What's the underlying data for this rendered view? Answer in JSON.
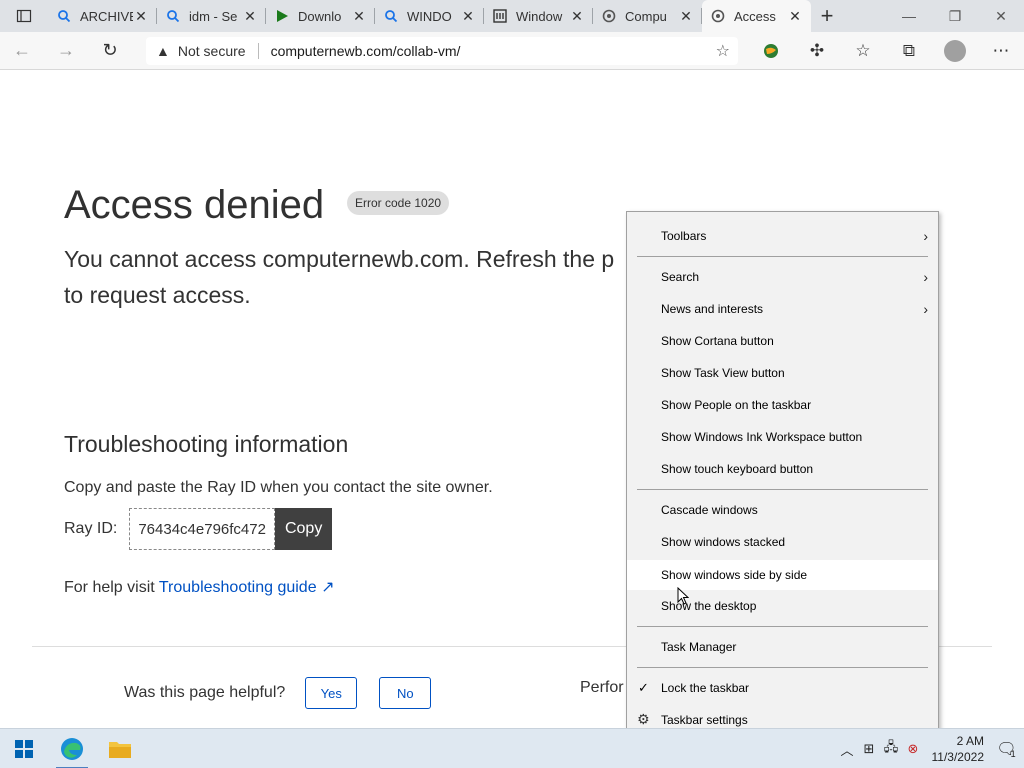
{
  "browser": {
    "tabs": [
      {
        "title": "ARCHIVE",
        "icon": "search-icon",
        "icon_color": "#1a73e8"
      },
      {
        "title": "idm - Se",
        "icon": "search-icon",
        "icon_color": "#1a73e8"
      },
      {
        "title": "Downlo",
        "icon": "play-icon",
        "icon_color": "#1b7a1b"
      },
      {
        "title": "WINDO",
        "icon": "search-icon",
        "icon_color": "#1a73e8"
      },
      {
        "title": "Window",
        "icon": "doc-icon",
        "icon_color": "#333333"
      },
      {
        "title": "Compu",
        "icon": "cloudflare-icon",
        "icon_color": "#555555"
      },
      {
        "title": "Access",
        "icon": "cloudflare-icon",
        "icon_color": "#555555",
        "active": true
      }
    ],
    "address": {
      "security_label": "Not secure",
      "url": "computernewb.com/collab-vm/"
    }
  },
  "page": {
    "title": "Access denied",
    "error_code": "Error code 1020",
    "description": "You cannot access computernewb.com. Refresh the page or contact the site owner to request access.",
    "description_visible": "You cannot access computernewb.com. Refresh the p",
    "description_line2": "to request access.",
    "troubleshooting_heading": "Troubleshooting information",
    "copy_instruction": "Copy and paste the Ray ID when you contact the site owner.",
    "ray_label": "Ray ID:",
    "ray_id": "76434c4e796fc472",
    "copy_button": "Copy",
    "help_prefix": "For help visit",
    "help_link": "Troubleshooting guide",
    "helpful_question": "Was this page helpful?",
    "yes_button": "Yes",
    "no_button": "No",
    "footer_partial": "Perfor"
  },
  "context_menu": {
    "items": [
      {
        "label": "Toolbars",
        "submenu": true
      },
      {
        "label": "Search",
        "submenu": true
      },
      {
        "label": "News and interests",
        "submenu": true
      },
      {
        "label": "Show Cortana button"
      },
      {
        "label": "Show Task View button"
      },
      {
        "label": "Show People on the taskbar"
      },
      {
        "label": "Show Windows Ink Workspace button"
      },
      {
        "label": "Show touch keyboard button"
      },
      {
        "label": "Cascade windows"
      },
      {
        "label": "Show windows stacked"
      },
      {
        "label": "Show windows side by side",
        "highlighted": true
      },
      {
        "label": "Show the desktop"
      },
      {
        "label": "Task Manager"
      },
      {
        "label": "Lock the taskbar",
        "checked": true
      },
      {
        "label": "Taskbar settings",
        "icon": "gear-icon"
      }
    ]
  },
  "taskbar": {
    "time": "2 AM",
    "date": "11/3/2022",
    "notification_count": "1"
  },
  "colors": {
    "accent_link": "#0051c3",
    "copy_button_bg": "#404040",
    "menu_bg": "#f2f2f2",
    "taskbar_bg": "#dfe8f1"
  }
}
